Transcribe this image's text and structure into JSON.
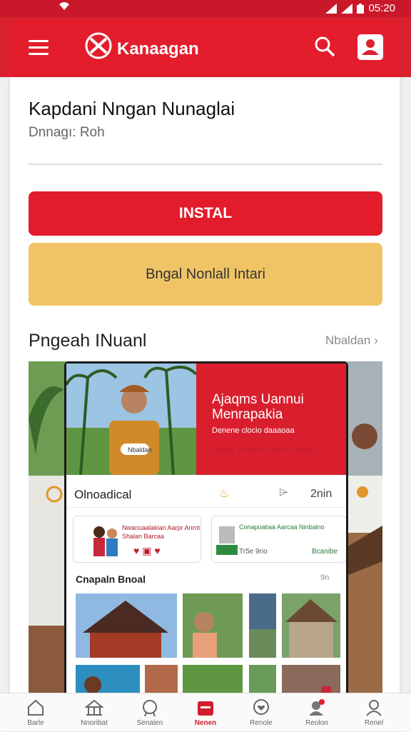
{
  "status_bar": {
    "time": "05:20"
  },
  "header": {
    "app_name": "Kanaagan"
  },
  "page": {
    "title": "Kapdani Nngan Nunaglai",
    "subtitle": "Dnnagı: Roh",
    "install_label": "INSTAL",
    "secondary_label": "Bngal Nonlall Intari"
  },
  "gallery": {
    "title": "Pngeah INuanl",
    "link": "Nbaldan"
  },
  "phone": {
    "banner_title_1": "Ajaqms Uannui",
    "banner_title_2": "Menrapakia",
    "banner_meta": "Denene clocio daaaoaa",
    "banner_subtext": "Mape poiooo nuinol otitoil",
    "chip": "Nbaldan",
    "row_label": "Olnoadical",
    "row_time": "2nin",
    "card1_title": "Nwanuaalakian Aarpr Anrnt Shalan Barcaa",
    "card2_title": "Conapuatiaa Aarcaa Ninbalno",
    "card2_meta": "Tr5e 9rio",
    "card2_link": "Bcanibe",
    "section_title": "Cnapaln Bnoal",
    "section_link": "9n"
  },
  "bottom_nav": [
    {
      "label": "Barle",
      "icon": "home-icon"
    },
    {
      "label": "Nnoribat",
      "icon": "temple-icon"
    },
    {
      "label": "Senalen",
      "icon": "badge-icon"
    },
    {
      "label": "Nenen",
      "icon": "calendar-icon"
    },
    {
      "label": "Renole",
      "icon": "heart-location-icon"
    },
    {
      "label": "Reolon",
      "icon": "notification-icon"
    },
    {
      "label": "Renel",
      "icon": "profile-icon"
    }
  ],
  "colors": {
    "brand_red": "#e31d2c",
    "accent_gold": "#f0c466"
  }
}
